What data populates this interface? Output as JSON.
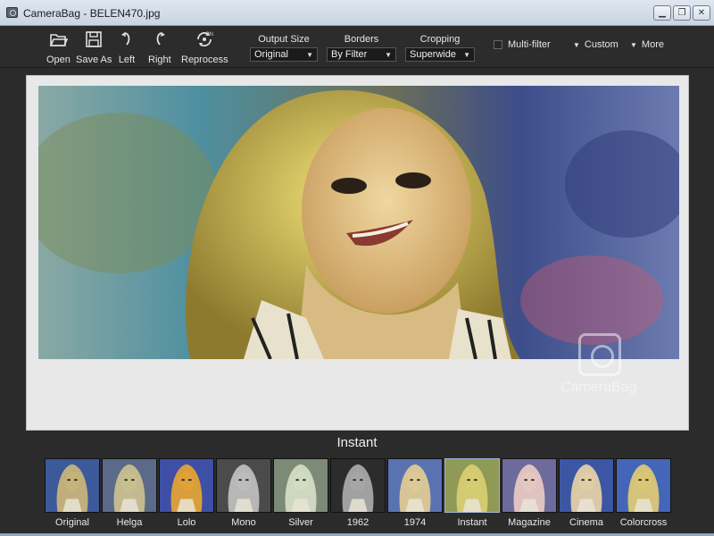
{
  "window": {
    "title": "CameraBag - BELEN470.jpg",
    "minimize": "▁",
    "restore": "❐",
    "close": "✕"
  },
  "toolbar": {
    "buttons": [
      {
        "label": "Open",
        "icon": "folder-open-icon"
      },
      {
        "label": "Save As",
        "icon": "floppy-disk-icon"
      },
      {
        "label": "Left",
        "icon": "rotate-left-icon"
      },
      {
        "label": "Right",
        "icon": "rotate-right-icon"
      },
      {
        "label": "Reprocess",
        "icon": "reprocess-icon",
        "badge": "ON"
      }
    ],
    "dropdowns": [
      {
        "label": "Output Size",
        "value": "Original"
      },
      {
        "label": "Borders",
        "value": "By Filter"
      },
      {
        "label": "Cropping",
        "value": "Superwide"
      }
    ],
    "multi_filter": {
      "label": "Multi-filter",
      "checked": false
    },
    "custom": "Custom",
    "more": "More"
  },
  "canvas": {
    "watermark": "CameraBag"
  },
  "current_filter": "Instant",
  "filters": [
    {
      "name": "Original",
      "tint": "#c7b47a",
      "bg": "#3c5a9a"
    },
    {
      "name": "Helga",
      "tint": "#c9c08f",
      "bg": "#5b6a88"
    },
    {
      "name": "Lolo",
      "tint": "#e2a236",
      "bg": "#3e4fa6"
    },
    {
      "name": "Mono",
      "tint": "#bdbdbd",
      "bg": "#4b4b4b"
    },
    {
      "name": "Silver",
      "tint": "#d3dcc4",
      "bg": "#7d8a78"
    },
    {
      "name": "1962",
      "tint": "#a8a8a8",
      "bg": "#2c2c2c"
    },
    {
      "name": "1974",
      "tint": "#dfc995",
      "bg": "#5a73b0"
    },
    {
      "name": "Instant",
      "tint": "#d7cc73",
      "bg": "#8e9a55"
    },
    {
      "name": "Magazine",
      "tint": "#e6c8c2",
      "bg": "#6d6a9c"
    },
    {
      "name": "Cinema",
      "tint": "#e3cfa6",
      "bg": "#3d56a4"
    },
    {
      "name": "Colorcross",
      "tint": "#dcc874",
      "bg": "#4466b8"
    }
  ],
  "selected_filter": "Instant"
}
